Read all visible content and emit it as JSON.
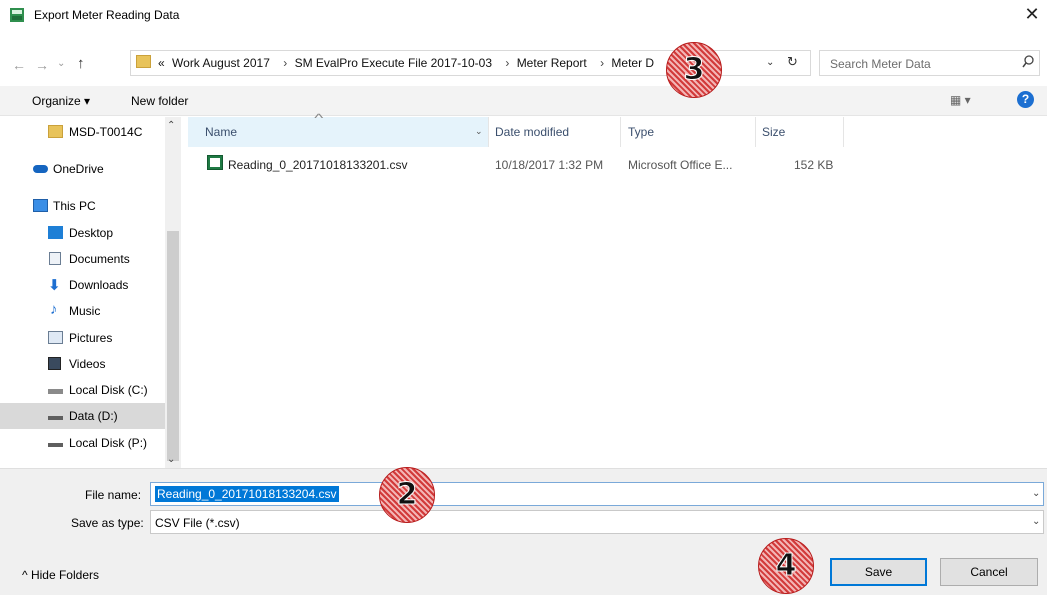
{
  "window": {
    "title": "Export Meter Reading Data",
    "close_glyph": "✕"
  },
  "nav": {
    "back": "←",
    "forward": "→",
    "recent": "⌄",
    "up": "↑"
  },
  "address": {
    "crumbs": [
      "«",
      "Work August 2017",
      "›",
      "SM EvalPro Execute File 2017-10-03",
      "›",
      "Meter Report",
      "›",
      "Meter D"
    ],
    "dropdown_glyph": "⌄",
    "refresh_glyph": "↻"
  },
  "search": {
    "placeholder": "Search Meter Data",
    "icon_glyph": "⚲"
  },
  "toolbar": {
    "organize_label": "Organize ▾",
    "new_folder_label": "New folder",
    "view_label": "▦ ▾",
    "help_glyph": "?"
  },
  "sidebar": {
    "items": [
      {
        "label": "MSD-T0014C",
        "icon": "folder-icon"
      },
      {
        "label": "OneDrive",
        "icon": "onedrive-icon"
      },
      {
        "label": "This PC",
        "icon": "computer-icon"
      },
      {
        "label": "Desktop",
        "icon": "desktop-icon"
      },
      {
        "label": "Documents",
        "icon": "documents-icon"
      },
      {
        "label": "Downloads",
        "icon": "downloads-icon"
      },
      {
        "label": "Music",
        "icon": "music-icon"
      },
      {
        "label": "Pictures",
        "icon": "pictures-icon"
      },
      {
        "label": "Videos",
        "icon": "videos-icon"
      },
      {
        "label": "Local Disk (C:)",
        "icon": "drive-c-icon"
      },
      {
        "label": "Data (D:)",
        "icon": "drive-icon"
      },
      {
        "label": "Local Disk (P:)",
        "icon": "drive-icon"
      }
    ],
    "selected": "Data (D:)",
    "scroll_up": "⌃",
    "scroll_down": "⌄"
  },
  "columns": {
    "name": "Name",
    "date": "Date modified",
    "type": "Type",
    "size": "Size",
    "sort_glyph": "^",
    "name_drop": "⌄"
  },
  "files": [
    {
      "name": "Reading_0_20171018133201.csv",
      "date": "10/18/2017 1:32 PM",
      "type": "Microsoft Office E...",
      "size": "152 KB"
    }
  ],
  "bottom": {
    "file_name_label": "File name:",
    "file_name_value": "Reading_0_20171018133204.csv",
    "save_type_label": "Save as type:",
    "save_type_value": "CSV File (*.csv)",
    "drop_glyph": "⌄",
    "hide_folders_label": "^  Hide Folders",
    "save_label": "Save",
    "cancel_label": "Cancel"
  },
  "callouts": [
    "3",
    "2",
    "4"
  ],
  "colors": {
    "accent": "#0078d7",
    "callout": "#d23a3a",
    "folder": "#e8c35a",
    "excel": "#1f7a44"
  }
}
